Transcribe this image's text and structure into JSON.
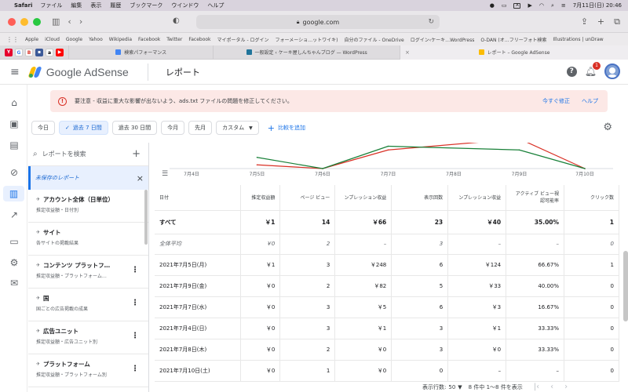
{
  "mac": {
    "app": "Safari",
    "menus": [
      "ファイル",
      "編集",
      "表示",
      "履歴",
      "ブックマーク",
      "ウインドウ",
      "ヘルプ"
    ],
    "datetime": "7月11日(日)  20:46"
  },
  "browser": {
    "url": "google.com",
    "bookmarks": [
      "Apple",
      "iCloud",
      "Google",
      "Yahoo",
      "Wikipedia",
      "Facebook",
      "Twitter",
      "Facebook",
      "マイポータル - ログイン",
      "フォーメーショ…ットワイキ)",
      "自分のファイル - OneDrive",
      "ログイン‹ケーキ…WordPress",
      "O-DAN (オ…フリーフォト検索",
      "Illustrations | unDraw"
    ],
    "tabs": [
      {
        "label": "検索パフォーマンス"
      },
      {
        "label": "一般設定 ‹ ケーキ屋しんちゃんブログ — WordPress"
      },
      {
        "label": "レポート – Google AdSense"
      }
    ]
  },
  "header": {
    "brand": "Google AdSense",
    "title": "レポート",
    "notification_count": "1"
  },
  "banner": {
    "text": "要注意 - 収益に重大な影響が出ないよう、ads.txt ファイルの問題を修正してください。",
    "fix_label": "今すぐ修正",
    "help_label": "ヘルプ"
  },
  "filters": {
    "chips": [
      {
        "label": "今日",
        "selected": false
      },
      {
        "label": "過去 7 日間",
        "selected": true
      },
      {
        "label": "過去 30 日間",
        "selected": false
      },
      {
        "label": "今月",
        "selected": false
      },
      {
        "label": "先月",
        "selected": false
      }
    ],
    "custom_label": "カスタム",
    "compare_label": "比較を追加"
  },
  "panel": {
    "search_placeholder": "レポートを検索",
    "unsaved_label": "未保存のレポート",
    "items": [
      {
        "title": "アカウント全体（日単位）",
        "subtitle": "推定収益額・日付別"
      },
      {
        "title": "サイト",
        "subtitle": "各サイトの掲載結果"
      },
      {
        "title": "コンテンツ プラットフ…",
        "subtitle": "推定収益額・プラットフォーム…"
      },
      {
        "title": "国",
        "subtitle": "国ごとの広告掲載の成果"
      },
      {
        "title": "広告ユニット",
        "subtitle": "推定収益額・広告ユニット別"
      },
      {
        "title": "プラットフォーム",
        "subtitle": "推定収益額・プラットフォーム別"
      }
    ]
  },
  "chart_data": {
    "type": "line",
    "categories": [
      "7月4日",
      "7月5日",
      "7月6日",
      "7月7日",
      "7月8日",
      "7月9日",
      "7月10日"
    ],
    "series": [
      {
        "color": "#d93025",
        "values": [
          null,
          1,
          0,
          5,
          null,
          82,
          0
        ]
      },
      {
        "color": "#188038",
        "values": [
          null,
          3,
          0,
          6,
          null,
          5,
          0
        ]
      }
    ],
    "note": "only the lower portion of the chart is visible"
  },
  "table": {
    "headers": [
      "日付",
      "推定収益額",
      "ページ ビュー",
      "ンプレッション収益",
      "表示回数",
      "ンプレッション収益",
      "アクティブ ビュー視認可能率",
      "クリック数"
    ],
    "total": [
      "すべて",
      "￥1",
      "14",
      "￥66",
      "23",
      "￥40",
      "35.00%",
      "1"
    ],
    "average": [
      "全体平均",
      "￥0",
      "2",
      "–",
      "3",
      "–",
      "–",
      "0"
    ],
    "rows": [
      [
        "2021年7月5日(月)",
        "￥1",
        "3",
        "￥248",
        "6",
        "￥124",
        "66.67%",
        "1"
      ],
      [
        "2021年7月9日(金)",
        "￥0",
        "2",
        "￥82",
        "5",
        "￥33",
        "40.00%",
        "0"
      ],
      [
        "2021年7月7日(水)",
        "￥0",
        "3",
        "￥5",
        "6",
        "￥3",
        "16.67%",
        "0"
      ],
      [
        "2021年7月4日(日)",
        "￥0",
        "3",
        "￥1",
        "3",
        "￥1",
        "33.33%",
        "0"
      ],
      [
        "2021年7月8日(木)",
        "￥0",
        "2",
        "￥0",
        "3",
        "￥0",
        "33.33%",
        "0"
      ],
      [
        "2021年7月10日(土)",
        "￥0",
        "1",
        "￥0",
        "0",
        "–",
        "–",
        "0"
      ]
    ]
  },
  "pagination": {
    "rows_label": "表示行数:",
    "rows_value": "50",
    "range": "8 件中 1～8 件を表示"
  }
}
